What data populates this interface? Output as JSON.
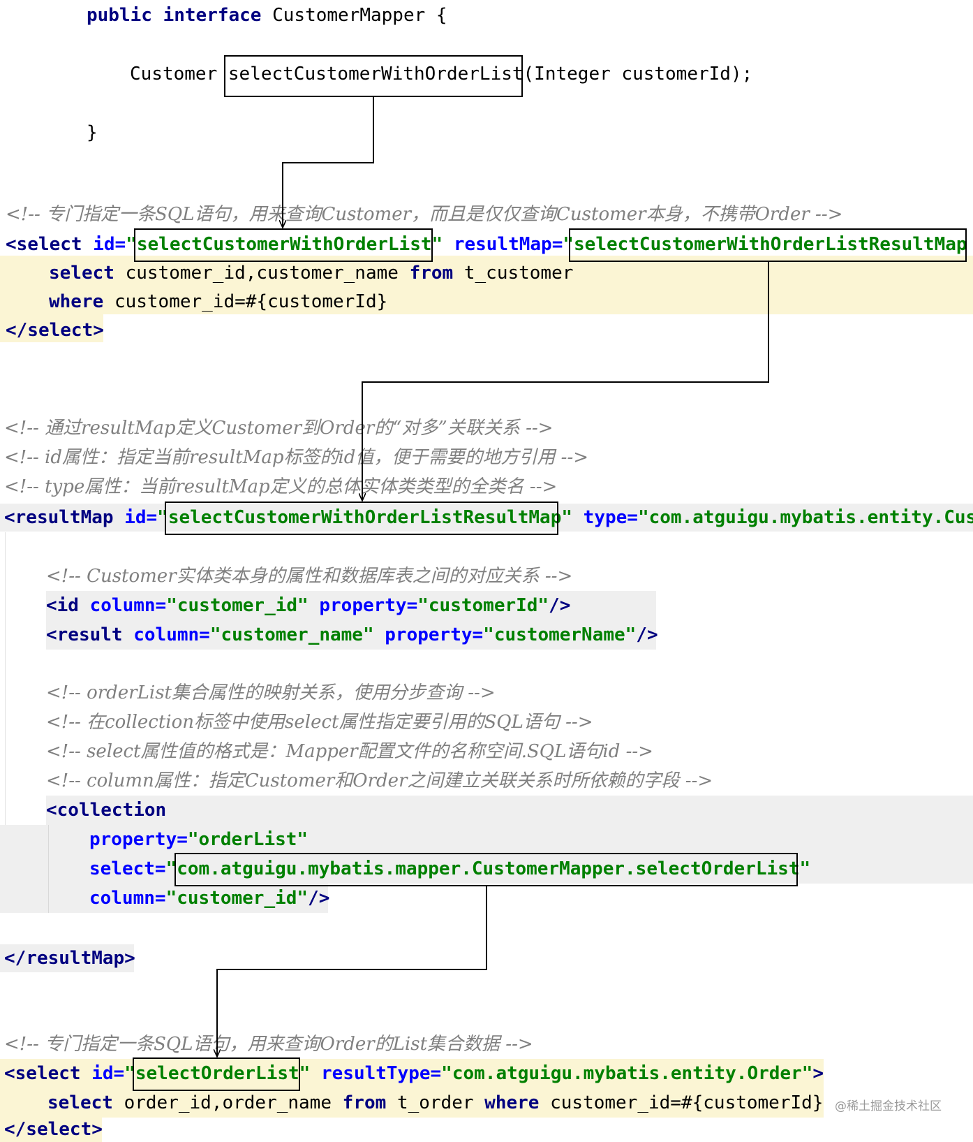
{
  "java": {
    "line1_kw1": "public",
    "line1_kw2": "interface",
    "line1_name": "CustomerMapper {",
    "line2_type": "Customer",
    "line2_method": "selectCustomerWithOrderList",
    "line2_params": "(Integer customerId);",
    "line3": "}"
  },
  "select1": {
    "comment": "<!-- 专门指定一条SQL语句，用来查询Customer，而且是仅仅查询Customer本身，不携带Order -->",
    "open_tag": "<select",
    "id_attr": "id=",
    "q": "\"",
    "id_value": "selectCustomerWithOrderList",
    "resultmap_attr": "resultMap=",
    "resultmap_value": "selectCustomerWithOrderListResultMap",
    "sql1_kw": "select",
    "sql1_cols": "customer_id,customer_name",
    "sql1_from": "from",
    "sql1_table": "t_customer",
    "sql2_kw": "where",
    "sql2_cond": "customer_id=#{customerId}",
    "close_tag": "</select>"
  },
  "resultmap": {
    "comment1": "<!-- 通过resultMap定义Customer到Order的“对多”关联关系 -->",
    "comment2": "<!-- id属性：指定当前resultMap标签的id值，便于需要的地方引用 -->",
    "comment3": "<!-- type属性：当前resultMap定义的总体实体类类型的全类名 -->",
    "open_tag": "<resultMap",
    "id_attr": "id=",
    "id_value": "selectCustomerWithOrderListResultMap",
    "type_attr": "type=",
    "type_value": "\"com.atguigu.mybatis.entity.Cus",
    "comment4": "<!-- Customer实体类本身的属性和数据库表之间的对应关系 -->",
    "id_line_tag": "<id",
    "id_line_col_attr": "column=",
    "id_line_col_val": "\"customer_id\"",
    "id_line_prop_attr": "property=",
    "id_line_prop_val": "\"customerId\"",
    "id_line_end": "/>",
    "result_tag": "<result",
    "result_col_attr": "column=",
    "result_col_val": "\"customer_name\"",
    "result_prop_attr": "property=",
    "result_prop_val": "\"customerName\"",
    "result_end": "/>",
    "comment5": "<!-- orderList集合属性的映射关系，使用分步查询 -->",
    "comment6": "<!-- 在collection标签中使用select属性指定要引用的SQL语句 -->",
    "comment7": "<!-- select属性值的格式是：Mapper配置文件的名称空间.SQL语句id -->",
    "comment8": "<!-- column属性：指定Customer和Order之间建立关联关系时所依赖的字段 -->",
    "collection_tag": "<collection",
    "prop_attr": "property=",
    "prop_val": "\"orderList\"",
    "select_attr": "select=",
    "select_val": "com.atguigu.mybatis.mapper.CustomerMapper.selectOrderList",
    "column_attr": "column=",
    "column_val": "\"customer_id\"",
    "column_end": "/>",
    "close_tag": "</resultMap>"
  },
  "select2": {
    "comment": "<!-- 专门指定一条SQL语句，用来查询Order的List集合数据 -->",
    "open_tag": "<select",
    "id_attr": "id=",
    "id_value": "selectOrderList",
    "resulttype_attr": "resultType=",
    "resulttype_value": "\"com.atguigu.mybatis.entity.Order\"",
    "tag_end": ">",
    "sql_kw": "select",
    "sql_cols": "order_id,order_name",
    "sql_from": "from",
    "sql_table": "t_order",
    "sql_where": "where",
    "sql_cond": "customer_id=#{customerId}",
    "close_tag": "</select>"
  },
  "watermark": "@稀土掘金技术社区"
}
